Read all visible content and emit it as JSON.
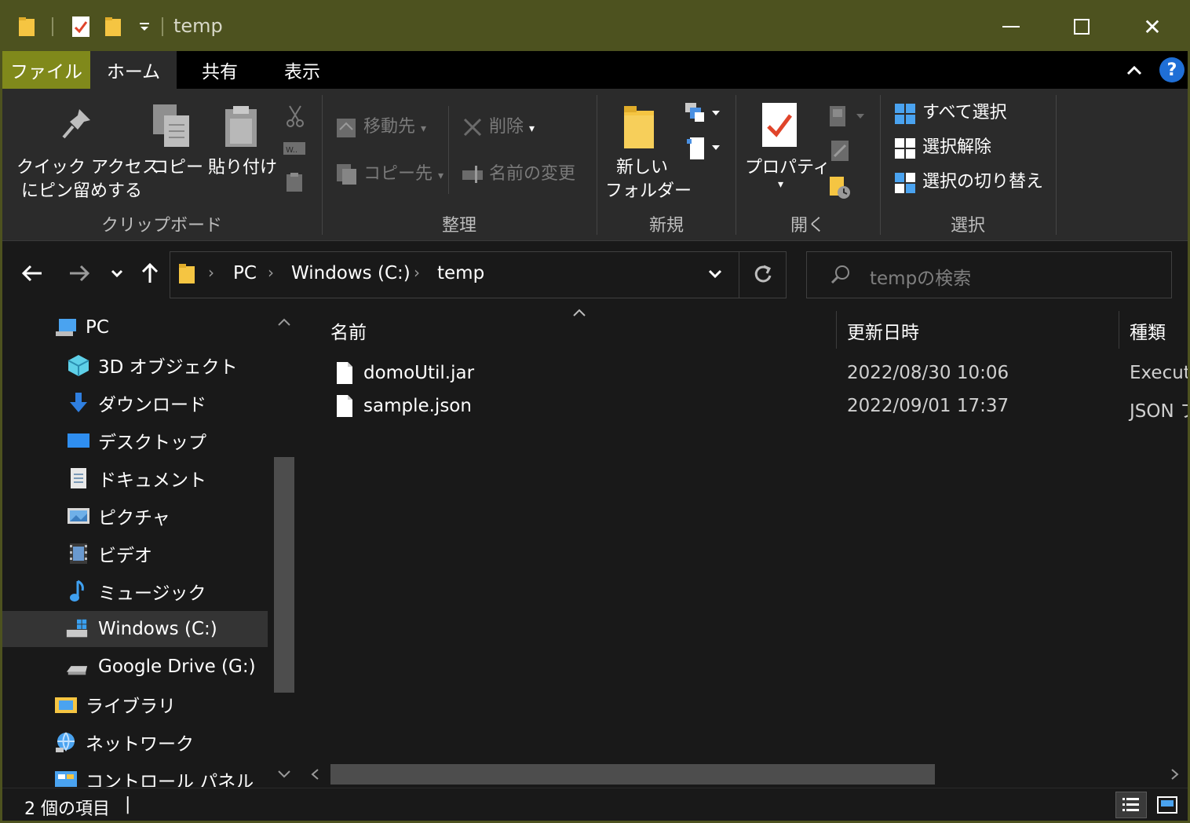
{
  "window": {
    "title": "temp",
    "controls": {
      "minimize": "—",
      "maximize": "☐",
      "close": "✕"
    }
  },
  "tabs": [
    {
      "label": "ファイル"
    },
    {
      "label": "ホーム"
    },
    {
      "label": "共有"
    },
    {
      "label": "表示"
    }
  ],
  "ribbon": {
    "clipboard": {
      "pin_line1": "クイック アクセス",
      "pin_line2": "にピン留めする",
      "copy": "コピー",
      "paste": "貼り付け",
      "group": "クリップボード"
    },
    "organize": {
      "move_to": "移動先",
      "copy_to": "コピー先",
      "delete": "削除",
      "rename": "名前の変更",
      "group": "整理"
    },
    "new": {
      "new_folder_line1": "新しい",
      "new_folder_line2": "フォルダー",
      "group": "新規"
    },
    "open": {
      "properties": "プロパティ",
      "group": "開く"
    },
    "select": {
      "select_all": "すべて選択",
      "select_none": "選択解除",
      "invert": "選択の切り替え",
      "group": "選択"
    }
  },
  "address": {
    "crumbs": [
      "PC",
      "Windows (C:)",
      "temp"
    ],
    "search_placeholder": "tempの検索"
  },
  "navpane": {
    "items": [
      {
        "label": "PC",
        "icon": "pc-icon"
      },
      {
        "label": "3D オブジェクト",
        "icon": "3d-objects-icon"
      },
      {
        "label": "ダウンロード",
        "icon": "download-icon"
      },
      {
        "label": "デスクトップ",
        "icon": "desktop-icon"
      },
      {
        "label": "ドキュメント",
        "icon": "documents-icon"
      },
      {
        "label": "ピクチャ",
        "icon": "pictures-icon"
      },
      {
        "label": "ビデオ",
        "icon": "video-icon"
      },
      {
        "label": "ミュージック",
        "icon": "music-icon"
      },
      {
        "label": "Windows (C:)",
        "icon": "drive-icon"
      },
      {
        "label": "Google Drive (G:)",
        "icon": "drive-icon"
      },
      {
        "label": "ライブラリ",
        "icon": "library-icon"
      },
      {
        "label": "ネットワーク",
        "icon": "network-icon"
      },
      {
        "label": "コントロール パネル",
        "icon": "control-panel-icon"
      }
    ],
    "selected_item": "Windows (C:)"
  },
  "filelist": {
    "columns": [
      "名前",
      "更新日時",
      "種類"
    ],
    "rows": [
      {
        "name": "domoUtil.jar",
        "modified": "2022/08/30 10:06",
        "type": "Executa"
      },
      {
        "name": "sample.json",
        "modified": "2022/09/01 17:37",
        "type": "JSON フ"
      }
    ]
  },
  "status": {
    "item_count": "2 個の項目",
    "separator": "|"
  },
  "colors": {
    "title_bar": "#4d521f",
    "file_tab": "#80891b",
    "ribbon": "#2b2b2b",
    "background": "#191919"
  }
}
